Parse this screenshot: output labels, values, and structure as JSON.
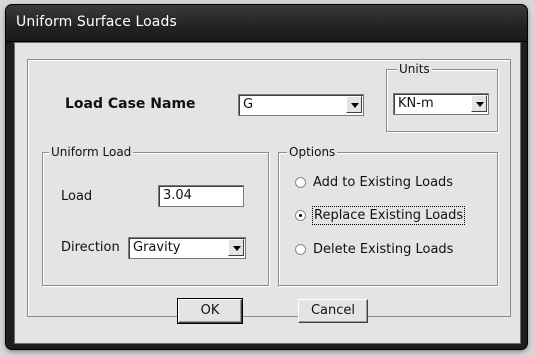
{
  "window": {
    "title": "Uniform Surface Loads"
  },
  "load_case": {
    "label": "Load Case Name",
    "value": "G"
  },
  "units": {
    "legend": "Units",
    "value": "KN-m"
  },
  "uniform_load": {
    "legend": "Uniform Load",
    "load_label": "Load",
    "load_value": "3.04",
    "direction_label": "Direction",
    "direction_value": "Gravity"
  },
  "options": {
    "legend": "Options",
    "items": [
      {
        "label": "Add to Existing Loads",
        "selected": false
      },
      {
        "label": "Replace Existing Loads",
        "selected": true
      },
      {
        "label": "Delete Existing Loads",
        "selected": false
      }
    ]
  },
  "buttons": {
    "ok": "OK",
    "cancel": "Cancel"
  },
  "colors": {
    "titlebar": "#222222",
    "dialog_bg": "#e4e4e4"
  },
  "icons": {
    "combo_arrow": "chevron-down-icon",
    "radio": "radio-icon"
  }
}
